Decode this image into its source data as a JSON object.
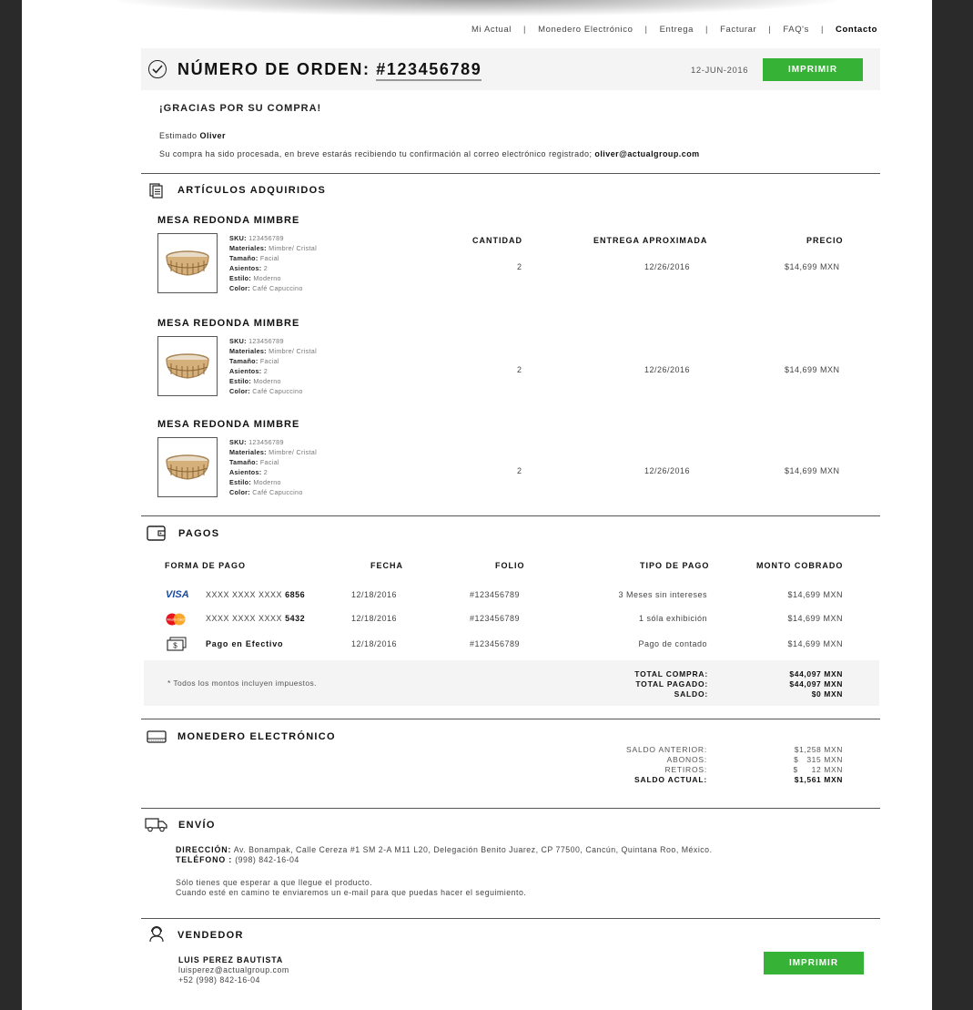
{
  "nav": {
    "items": [
      "Mi Actual",
      "Monedero Electrónico",
      "Entrega",
      "Facturar",
      "FAQ's",
      "Contacto"
    ],
    "active": "Contacto"
  },
  "order": {
    "label": "NÚMERO DE ORDEN:",
    "number": "#123456789",
    "date": "12-JUN-2016",
    "print_label": "IMPRIMIR"
  },
  "confirmation": {
    "thanks": "¡GRACIAS POR SU COMPRA!",
    "greeting_prefix": "Estimado",
    "customer_name": "Oliver",
    "processed_text": "Su compra ha sido procesada, en breve estarás recibiendo tu confirmación al correo electrónico registrado;",
    "email": "oliver@actualgroup.com"
  },
  "articles": {
    "title": "ARTÍCULOS ADQUIRIDOS",
    "columns": [
      "CANTIDAD",
      "ENTREGA APROXIMADA",
      "PRECIO"
    ],
    "spec_labels": {
      "sku": "SKU:",
      "materials": "Materiales:",
      "size": "Tamaño:",
      "seats": "Asientos:",
      "style": "Estilo:",
      "color": "Color:"
    },
    "items": [
      {
        "name": "MESA REDONDA MIMBRE",
        "sku": "123456789",
        "materials": "Mimbre/ Cristal",
        "size": "Facial",
        "seats": "2",
        "style": "Moderno",
        "color": "Café Capuccino",
        "quantity": "2",
        "delivery": "12/26/2016",
        "price": "$14,699 MXN"
      },
      {
        "name": "MESA REDONDA MIMBRE",
        "sku": "123456789",
        "materials": "Mimbre/ Cristal",
        "size": "Facial",
        "seats": "2",
        "style": "Moderno",
        "color": "Café Capuccino",
        "quantity": "2",
        "delivery": "12/26/2016",
        "price": "$14,699 MXN"
      },
      {
        "name": "MESA REDONDA MIMBRE",
        "sku": "123456789",
        "materials": "Mimbre/ Cristal",
        "size": "Facial",
        "seats": "2",
        "style": "Moderno",
        "color": "Café Capuccino",
        "quantity": "2",
        "delivery": "12/26/2016",
        "price": "$14,699 MXN"
      }
    ]
  },
  "payments": {
    "title": "PAGOS",
    "columns": [
      "FORMA DE PAGO",
      "FECHA",
      "FOLIO",
      "TIPO DE PAGO",
      "MONTO COBRADO"
    ],
    "rows": [
      {
        "icon": "visa-logo",
        "logo_text": "VISA",
        "method_prefix": "XXXX XXXX XXXX",
        "method_last": "6856",
        "date": "12/18/2016",
        "folio": "#123456789",
        "type": "3 Meses sin intereses",
        "amount": "$14,699 MXN"
      },
      {
        "icon": "mastercard-logo",
        "logo_text": "MasterCard",
        "method_prefix": "XXXX XXXX XXXX",
        "method_last": "5432",
        "date": "12/18/2016",
        "folio": "#123456789",
        "type": "1 sóla exhibición",
        "amount": "$14,699 MXN"
      },
      {
        "icon": "cash-icon",
        "method_prefix": "",
        "method_last": "Pago en Efectivo",
        "date": "12/18/2016",
        "folio": "#123456789",
        "type": "Pago de contado",
        "amount": "$14,699 MXN"
      }
    ],
    "note": "* Todos los montos incluyen impuestos.",
    "totals": {
      "labels": [
        "TOTAL COMPRA:",
        "TOTAL PAGADO:",
        "SALDO:"
      ],
      "values": [
        "$44,097 MXN",
        "$44,097 MXN",
        "$0 MXN"
      ]
    }
  },
  "wallet": {
    "title": "MONEDERO ELECTRÓNICO",
    "labels": [
      "SALDO ANTERIOR:",
      "ABONOS:",
      "RETIROS:",
      "SALDO ACTUAL:"
    ],
    "values": [
      "$1,258 MXN",
      "$   315 MXN",
      "$     12 MXN",
      "$1,561 MXN"
    ]
  },
  "shipping": {
    "title": "ENVÍO",
    "address_label": "DIRECCIÓN:",
    "address": "Av. Bonampak, Calle Cereza #1 SM 2-A M11 L20, Delegación Benito Juarez, CP 77500, Cancún, Quintana Roo, México.",
    "phone_label": "TELÉFONO :",
    "phone": "(998) 842-16-04",
    "message_line1": "Sólo tienes que esperar a que llegue el producto.",
    "message_line2": "Cuando esté en camino te enviaremos un e-mail para que puedas hacer el seguimiento."
  },
  "seller": {
    "title": "VENDEDOR",
    "name": "LUIS PEREZ BAUTISTA",
    "email": "luisperez@actualgroup.com",
    "phone": "+52 (998) 842-16-04",
    "print_label": "IMPRIMIR"
  },
  "colors": {
    "accent": "#36b236",
    "background": "#2a2a2a",
    "panel": "#f4f4f4"
  }
}
